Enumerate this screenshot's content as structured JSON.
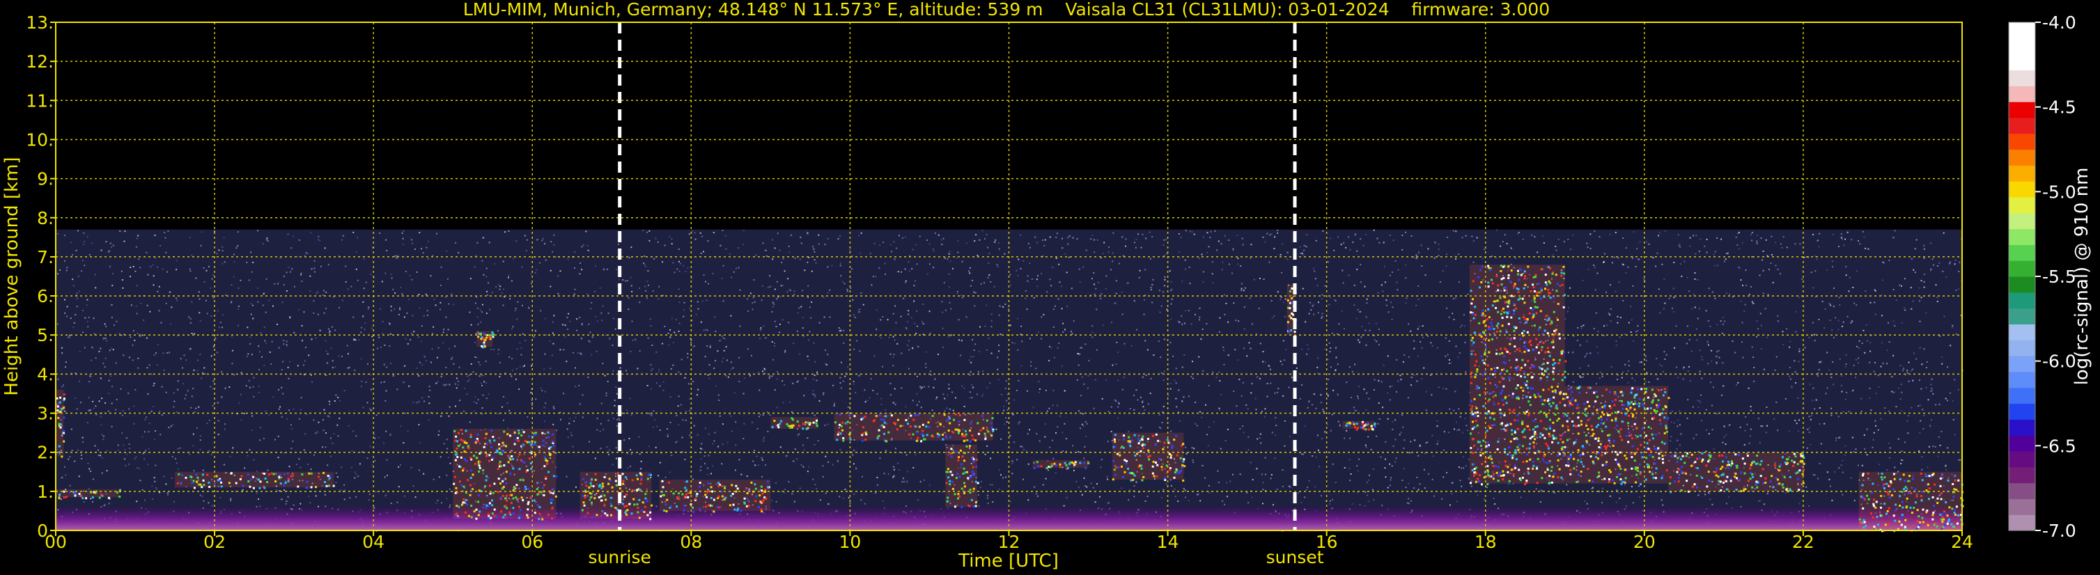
{
  "chart_data": {
    "type": "heatmap",
    "title": "LMU-MIM, Munich, Germany; 48.148° N 11.573° E, altitude: 539 m    Vaisala CL31 (CL31LMU): 03-01-2024    firmware: 3.000",
    "xlabel": "Time [UTC]",
    "ylabel": "Height above ground [km]",
    "xlim": [
      0,
      24
    ],
    "ylim": [
      0,
      13
    ],
    "x_ticks": [
      "00",
      "02",
      "04",
      "06",
      "08",
      "10",
      "12",
      "14",
      "16",
      "18",
      "20",
      "22",
      "24"
    ],
    "x_tick_values": [
      0,
      2,
      4,
      6,
      8,
      10,
      12,
      14,
      16,
      18,
      20,
      22,
      24
    ],
    "y_ticks": [
      "0.",
      "1.",
      "2.",
      "3.",
      "4.",
      "5.",
      "6.",
      "7.",
      "8.",
      "9.",
      "10.",
      "11.",
      "12.",
      "13."
    ],
    "y_tick_values": [
      0,
      1,
      2,
      3,
      4,
      5,
      6,
      7,
      8,
      9,
      10,
      11,
      12,
      13
    ],
    "grid": true,
    "data_top_km": 7.7,
    "markers": [
      {
        "label": "sunrise",
        "x": 7.1
      },
      {
        "label": "sunset",
        "x": 15.6
      }
    ],
    "colorbar": {
      "label": "log(rc-signal) @ 910 nm",
      "ticks": [
        "-4.0",
        "-4.5",
        "-5.0",
        "-5.5",
        "-6.0",
        "-6.5",
        "-7.0"
      ],
      "tick_values": [
        -4.0,
        -4.5,
        -5.0,
        -5.5,
        -6.0,
        -6.5,
        -7.0
      ],
      "range": [
        -7.0,
        -4.0
      ],
      "colors": [
        "#b090b0",
        "#9a7098",
        "#864e86",
        "#741e78",
        "#660c82",
        "#52009c",
        "#2a10c8",
        "#2244f0",
        "#3f70f8",
        "#5e8cf8",
        "#7aa2f8",
        "#92b2f0",
        "#a4c0f0",
        "#3aa08c",
        "#1e9a78",
        "#1c8c20",
        "#36b030",
        "#58d050",
        "#8ee866",
        "#c4f080",
        "#e4f040",
        "#f8d800",
        "#fcae00",
        "#fc8000",
        "#f84800",
        "#e81e1e",
        "#ea0000",
        "#f4b8b8",
        "#ecdede",
        "#ffffff",
        "#ffffff",
        "#ffffff"
      ]
    },
    "cloud_layers": [
      {
        "start": 0.0,
        "end": 0.1,
        "bottom": 1.9,
        "top": 3.6
      },
      {
        "start": 0.0,
        "end": 0.8,
        "bottom": 0.85,
        "top": 1.05
      },
      {
        "start": 1.5,
        "end": 3.5,
        "bottom": 1.1,
        "top": 1.5
      },
      {
        "start": 5.3,
        "end": 5.5,
        "bottom": 4.7,
        "top": 5.1
      },
      {
        "start": 5.0,
        "end": 6.3,
        "bottom": 0.3,
        "top": 2.6
      },
      {
        "start": 6.6,
        "end": 7.5,
        "bottom": 0.3,
        "top": 1.5
      },
      {
        "start": 7.6,
        "end": 9.0,
        "bottom": 0.5,
        "top": 1.3
      },
      {
        "start": 9.0,
        "end": 9.6,
        "bottom": 2.6,
        "top": 2.9
      },
      {
        "start": 9.8,
        "end": 11.8,
        "bottom": 2.3,
        "top": 3.0
      },
      {
        "start": 11.2,
        "end": 11.6,
        "bottom": 0.6,
        "top": 2.2
      },
      {
        "start": 12.3,
        "end": 13.0,
        "bottom": 1.6,
        "top": 1.8
      },
      {
        "start": 13.3,
        "end": 14.2,
        "bottom": 1.3,
        "top": 2.5
      },
      {
        "start": 15.5,
        "end": 15.6,
        "bottom": 5.0,
        "top": 6.3
      },
      {
        "start": 16.2,
        "end": 16.6,
        "bottom": 2.6,
        "top": 2.8
      },
      {
        "start": 17.8,
        "end": 19.0,
        "bottom": 1.2,
        "top": 6.8
      },
      {
        "start": 19.0,
        "end": 20.3,
        "bottom": 1.2,
        "top": 3.7
      },
      {
        "start": 20.3,
        "end": 22.0,
        "bottom": 1.0,
        "top": 2.0
      },
      {
        "start": 22.7,
        "end": 24.0,
        "bottom": 0.0,
        "top": 1.5
      }
    ]
  }
}
